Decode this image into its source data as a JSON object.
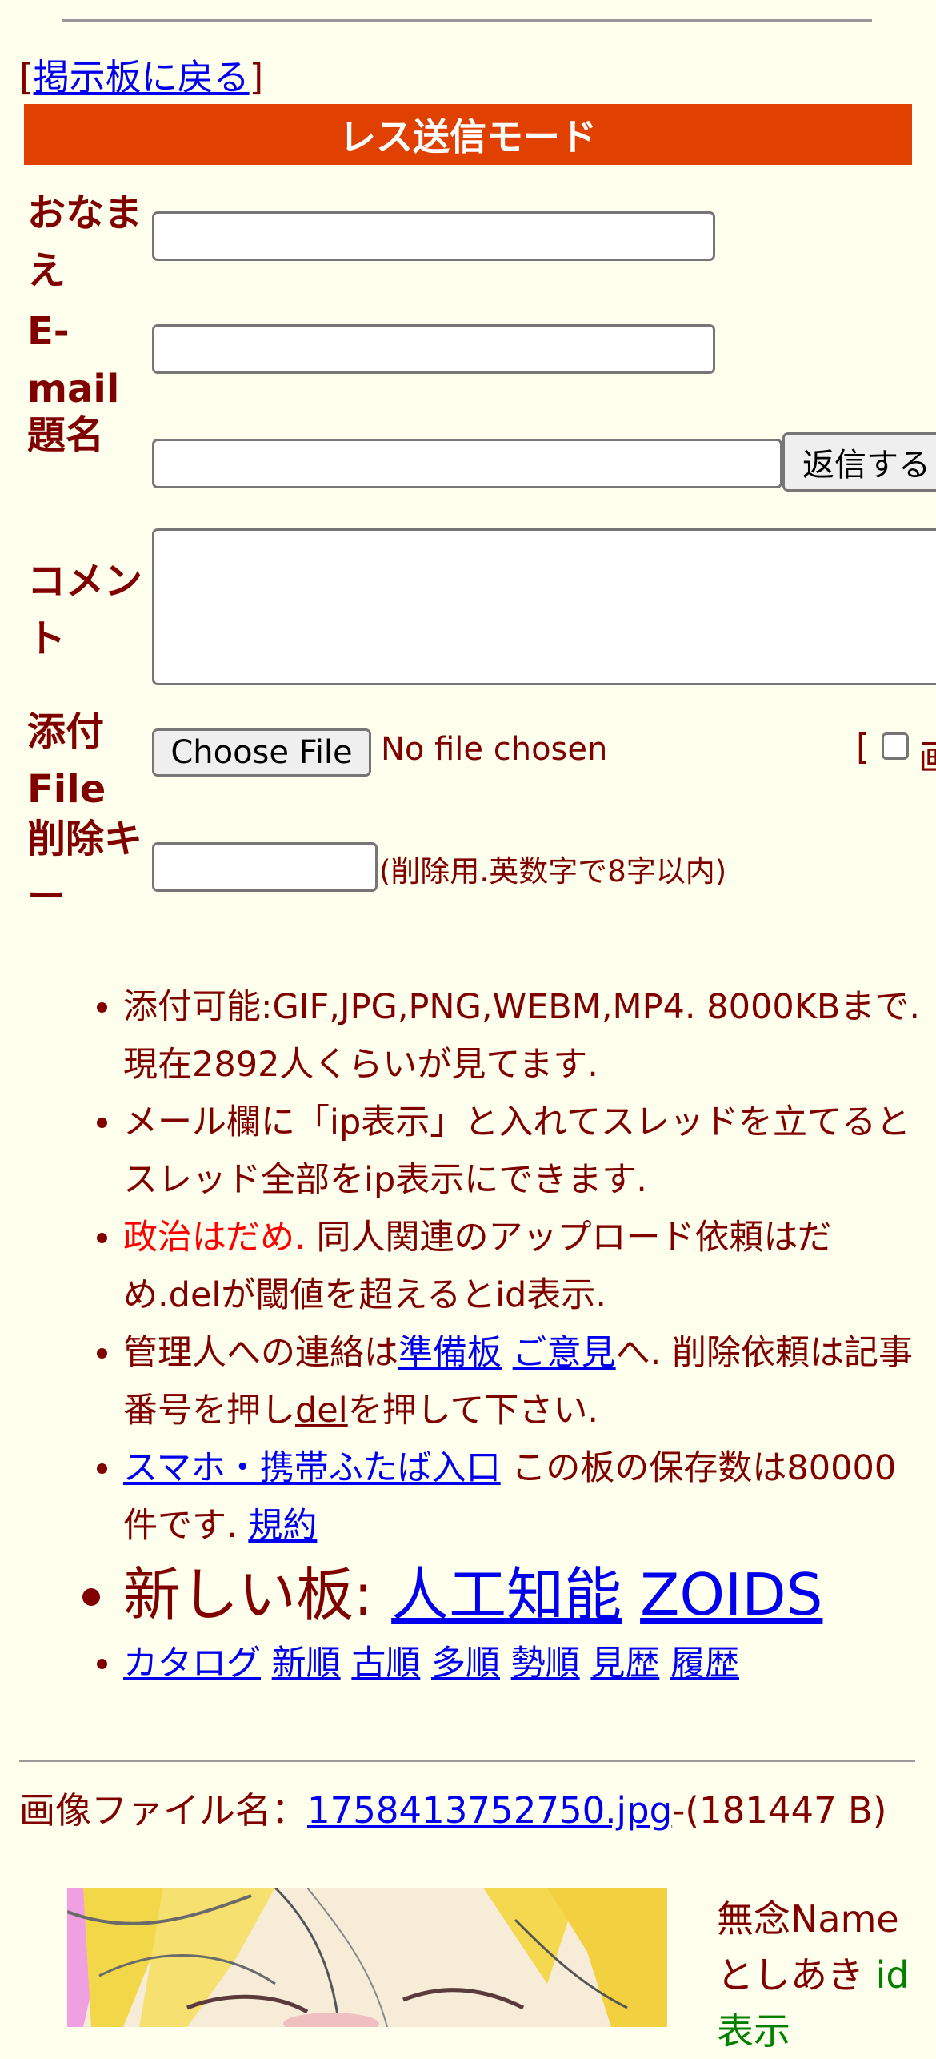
{
  "nav": {
    "back_bracket_open": "[",
    "back_link": "掲示板に戻る",
    "back_bracket_close": "]"
  },
  "banner": "レス送信モード",
  "form": {
    "name_label": "おなまえ",
    "email_label": "E-mail",
    "subject_label": "題名",
    "submit_button": "返信する",
    "comment_label": "コメント",
    "file_label": "添付File",
    "choose_file_button": "Choose File",
    "no_file_text": "No file chosen",
    "image_option_prefix": "[",
    "image_option_label": "画",
    "delkey_label": "削除キー",
    "delkey_hint": "(削除用.英数字で8字以内)"
  },
  "notes": {
    "attach_info": "添付可能:GIF,JPG,PNG,WEBM,MP4. 8000KBまで. 現在2892人くらいが見てます.",
    "ip_info": "メール欄に「ip表示」と入れてスレッドを立てるとスレッド全部をip表示にできます.",
    "politics": "政治はだめ.",
    "doujin_info": " 同人関連のアップロード依頼はだめ.delが閾値を超えるとid表示.",
    "contact_prefix": "管理人への連絡は",
    "contact_link1": "準備板",
    "contact_link2": "ご意見",
    "contact_mid": "へ. 削除依頼は記事番号を押し",
    "contact_del": "del",
    "contact_suffix": "を押して下さい.",
    "mobile_link": "スマホ・携帯ふたば入口",
    "storage_info": " この板の保存数は80000件です. ",
    "terms_link": "規約",
    "new_boards_label": "新しい板: ",
    "new_board1": "人工知能",
    "new_board2": "ZOIDS",
    "sort_links": [
      "カタログ",
      "新順",
      "古順",
      "多順",
      "勢順",
      "見歴",
      "履歴"
    ]
  },
  "post": {
    "file_label": "画像ファイル名：",
    "file_name": "1758413752750.jpg",
    "file_size": "-(181447 B)",
    "poster_name": "無念Name",
    "poster_handle": "としあき",
    "id_link": "id表示"
  }
}
